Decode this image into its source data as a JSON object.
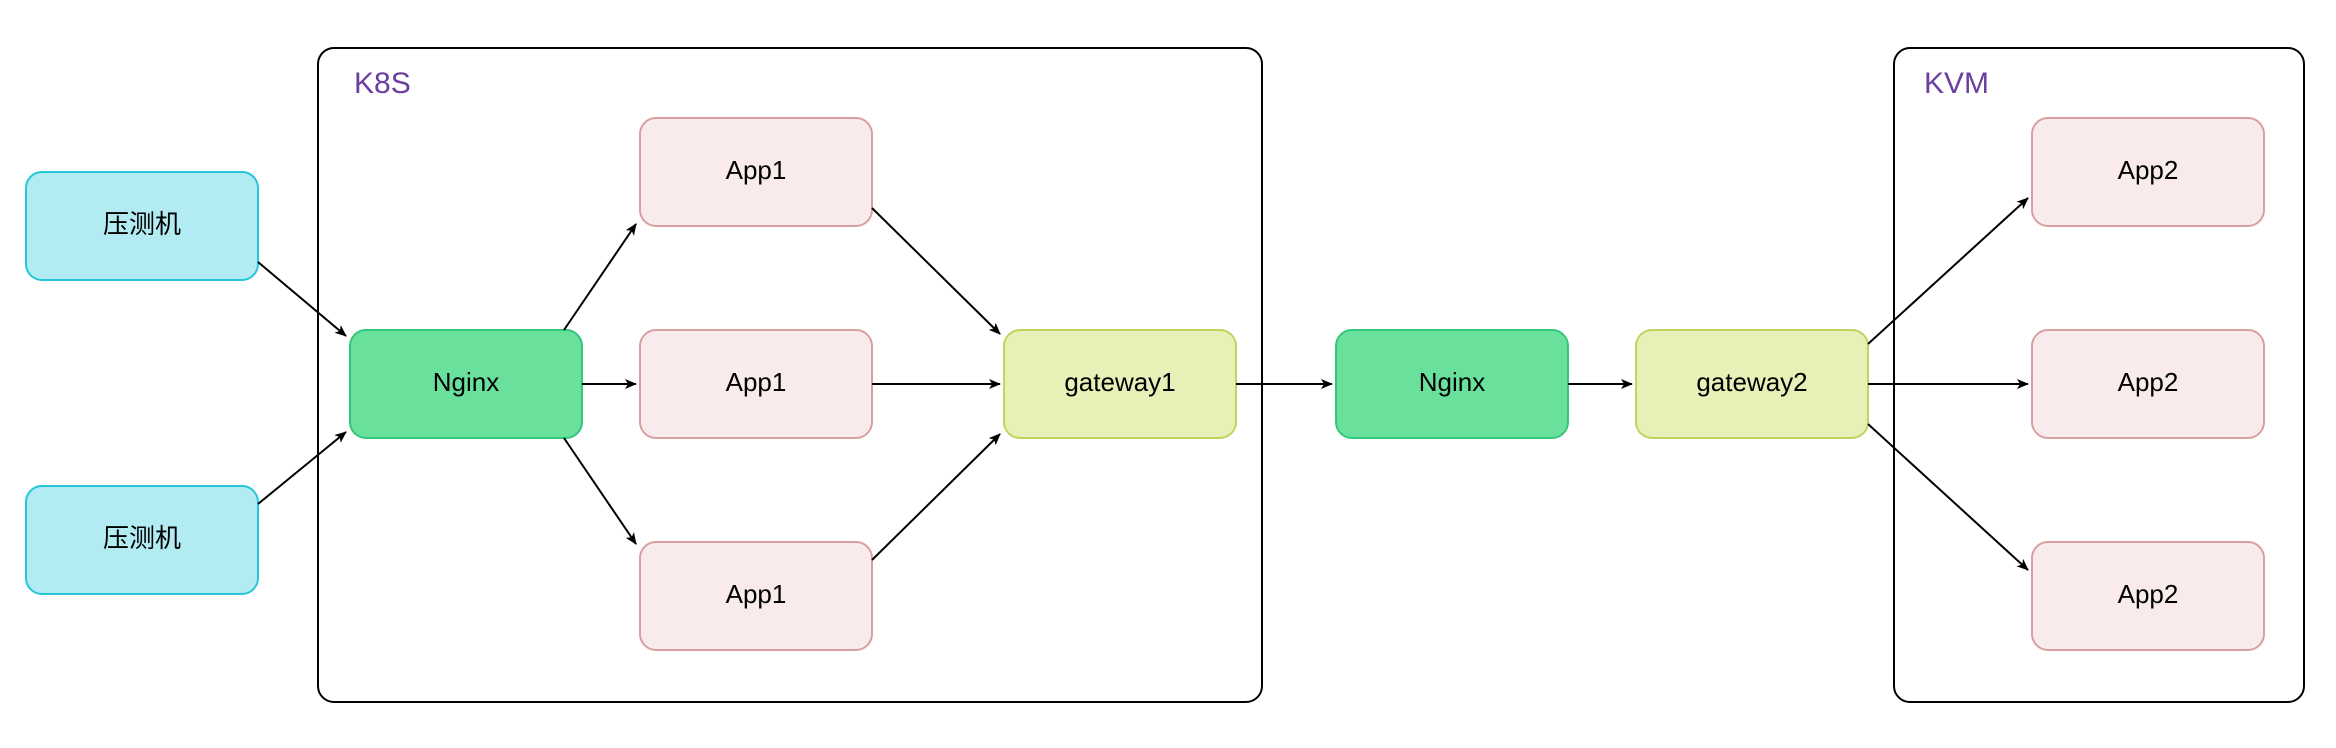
{
  "containers": {
    "k8s": {
      "label": "K8S"
    },
    "kvm": {
      "label": "KVM"
    }
  },
  "nodes": {
    "loadgen1": {
      "label": "压测机"
    },
    "loadgen2": {
      "label": "压测机"
    },
    "nginx1": {
      "label": "Nginx"
    },
    "app1a": {
      "label": "App1"
    },
    "app1b": {
      "label": "App1"
    },
    "app1c": {
      "label": "App1"
    },
    "gateway1": {
      "label": "gateway1"
    },
    "nginx2": {
      "label": "Nginx"
    },
    "gateway2": {
      "label": "gateway2"
    },
    "app2a": {
      "label": "App2"
    },
    "app2b": {
      "label": "App2"
    },
    "app2c": {
      "label": "App2"
    }
  },
  "colors": {
    "cyan_fill": "#B2EBF2",
    "cyan_stroke": "#26C6DA",
    "green_fill": "#69E09C",
    "green_stroke": "#34C77B",
    "pink_fill": "#F9EBEB",
    "pink_stroke": "#D9A0A0",
    "lime_fill": "#E8F0B8",
    "lime_stroke": "#C3D35F",
    "container_label": "#6B3FA0"
  }
}
